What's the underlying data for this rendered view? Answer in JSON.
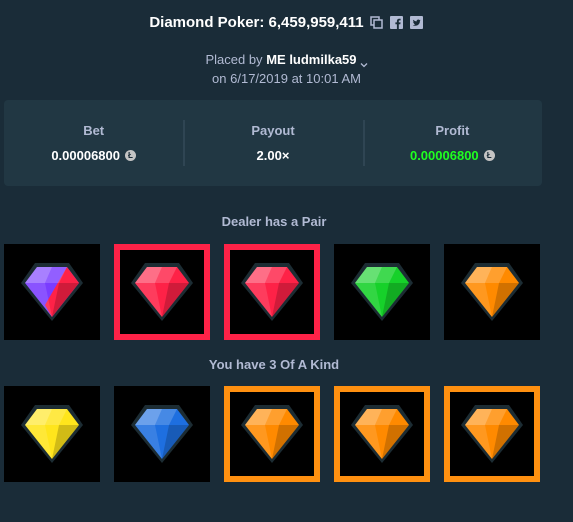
{
  "header": {
    "title": "Diamond Poker: 6,459,959,411",
    "placed_by_prefix": "Placed by",
    "badge": "ME",
    "username": "ludmilka59",
    "date_line": "on 6/17/2019 at 10:01 AM"
  },
  "stats": {
    "bet": {
      "label": "Bet",
      "value": "0.00006800"
    },
    "payout": {
      "label": "Payout",
      "value": "2.00×"
    },
    "profit": {
      "label": "Profit",
      "value": "0.00006800"
    }
  },
  "dealer": {
    "label": "Dealer has a Pair",
    "cards": [
      {
        "gem": "purple-red-split-gem",
        "highlight": "none"
      },
      {
        "gem": "red-gem",
        "highlight": "red"
      },
      {
        "gem": "red-gem",
        "highlight": "red"
      },
      {
        "gem": "green-gem",
        "highlight": "none"
      },
      {
        "gem": "orange-gem",
        "highlight": "none"
      }
    ]
  },
  "player": {
    "label": "You have 3 Of A Kind",
    "cards": [
      {
        "gem": "yellow-gem",
        "highlight": "none"
      },
      {
        "gem": "blue-gem",
        "highlight": "none"
      },
      {
        "gem": "orange-gem",
        "highlight": "orange"
      },
      {
        "gem": "orange-gem",
        "highlight": "orange"
      },
      {
        "gem": "orange-gem",
        "highlight": "orange"
      }
    ]
  },
  "colors": {
    "background": "#1a2c38",
    "panel": "#213743",
    "profit_green": "#1fff20",
    "highlight_red": "#fe2247",
    "highlight_orange": "#ff9010",
    "gem_red": "#fe2247",
    "gem_orange": "#ff8a00",
    "gem_green": "#16d12a",
    "gem_yellow": "#ffe51c",
    "gem_blue": "#1e6fe0",
    "gem_purple": "#7a3cff"
  }
}
